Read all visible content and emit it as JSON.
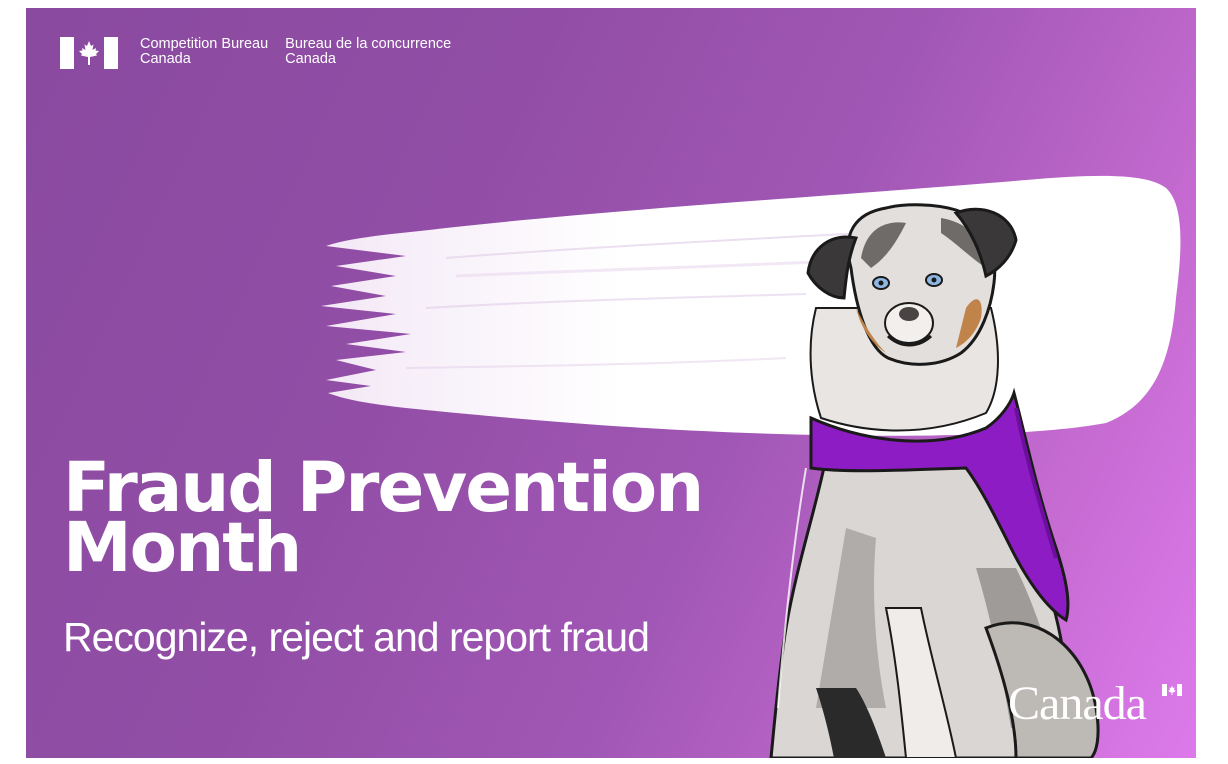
{
  "header": {
    "org_en_line1": "Competition Bureau",
    "org_en_line2": "Canada",
    "org_fr_line1": "Bureau de la concurrence",
    "org_fr_line2": "Canada"
  },
  "main": {
    "headline_line1": "Fraud Prevention",
    "headline_line2": "Month",
    "tagline": "Recognize, reject and report fraud"
  },
  "footer": {
    "wordmark": "Canada"
  },
  "illustration": {
    "subject": "australian-shepherd-dog",
    "bandana_color": "#8d1cc4"
  },
  "colors": {
    "background_start": "#8a4aa0",
    "background_end": "#dd7aeb",
    "text": "#ffffff"
  }
}
